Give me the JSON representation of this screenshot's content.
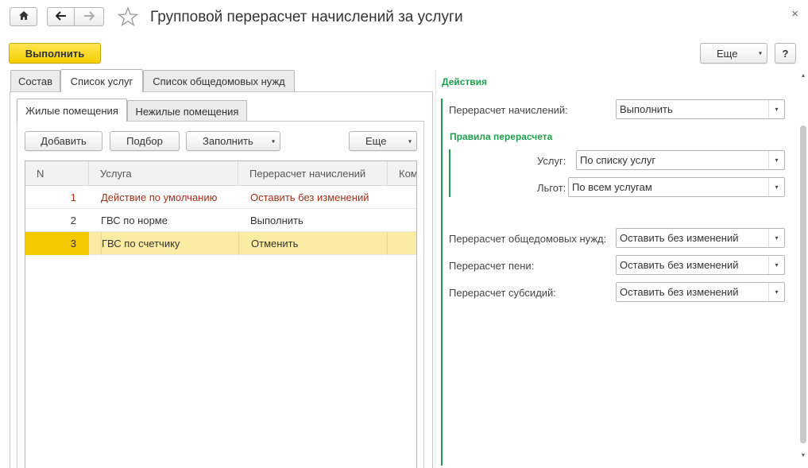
{
  "header": {
    "title": "Групповой перерасчет начислений за услуги",
    "close_glyph": "×",
    "home_icon": "home-icon",
    "back_icon": "arrow-left-icon",
    "forward_icon": "arrow-right-icon",
    "star_icon": "star-icon"
  },
  "toolbar": {
    "run_label": "Выполнить",
    "more_label": "Еще",
    "help_label": "?"
  },
  "tabs": [
    {
      "label": "Состав"
    },
    {
      "label": "Список услуг"
    },
    {
      "label": "Список общедомовых нужд"
    }
  ],
  "subtabs": [
    {
      "label": "Жилые помещения"
    },
    {
      "label": "Нежилые помещения"
    }
  ],
  "list_toolbar": {
    "add_label": "Добавить",
    "pick_label": "Подбор",
    "fill_label": "Заполнить",
    "more_label": "Еще"
  },
  "table": {
    "columns": [
      "N",
      "Услуга",
      "Перерасчет начислений",
      "Ком"
    ],
    "rows": [
      {
        "n": "1",
        "service": "Действие по умолчанию",
        "recalc": "Оставить без изменений"
      },
      {
        "n": "2",
        "service": "ГВС по норме",
        "recalc": "Выполнить"
      },
      {
        "n": "3",
        "service": "ГВС по счетчику",
        "recalc": "Отменить"
      }
    ]
  },
  "actions": {
    "title": "Действия",
    "recalc_label": "Перерасчет начислений:",
    "recalc_value": "Выполнить",
    "rules_title": "Правила перерасчета",
    "services_label": "Услуг:",
    "services_value": "По списку услуг",
    "benefits_label": "Льгот:",
    "benefits_value": "По всем услугам",
    "common_label": "Перерасчет общедомовых нужд:",
    "common_value": "Оставить без изменений",
    "penalty_label": "Перерасчет пени:",
    "penalty_value": "Оставить без изменений",
    "subsidy_label": "Перерасчет субсидий:",
    "subsidy_value": "Оставить без изменений"
  },
  "colors": {
    "accent_green": "#1e9f4d",
    "primary_yellow": "#f5cf00",
    "row_highlight": "#fbeca3",
    "default_row_text": "#a0311a"
  }
}
